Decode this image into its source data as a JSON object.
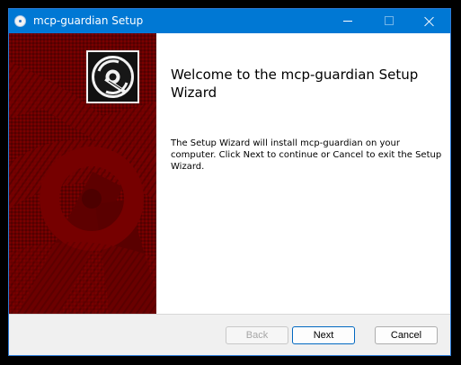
{
  "window": {
    "title": "mcp-guardian Setup",
    "accent_color": "#0078d4",
    "panel_color": "#6d0000"
  },
  "titlebar": {
    "app_icon": "installer-icon",
    "minimize_icon": "minimize-icon",
    "maximize_icon": "maximize-icon",
    "close_icon": "close-icon"
  },
  "wizard": {
    "heading": "Welcome to the mcp-guardian Setup Wizard",
    "description": "The Setup Wizard will install mcp-guardian on your computer. Click Next to continue or Cancel to exit the Setup Wizard.",
    "logo_icon": "disc-icon"
  },
  "buttons": {
    "back": "Back",
    "next": "Next",
    "cancel": "Cancel"
  }
}
